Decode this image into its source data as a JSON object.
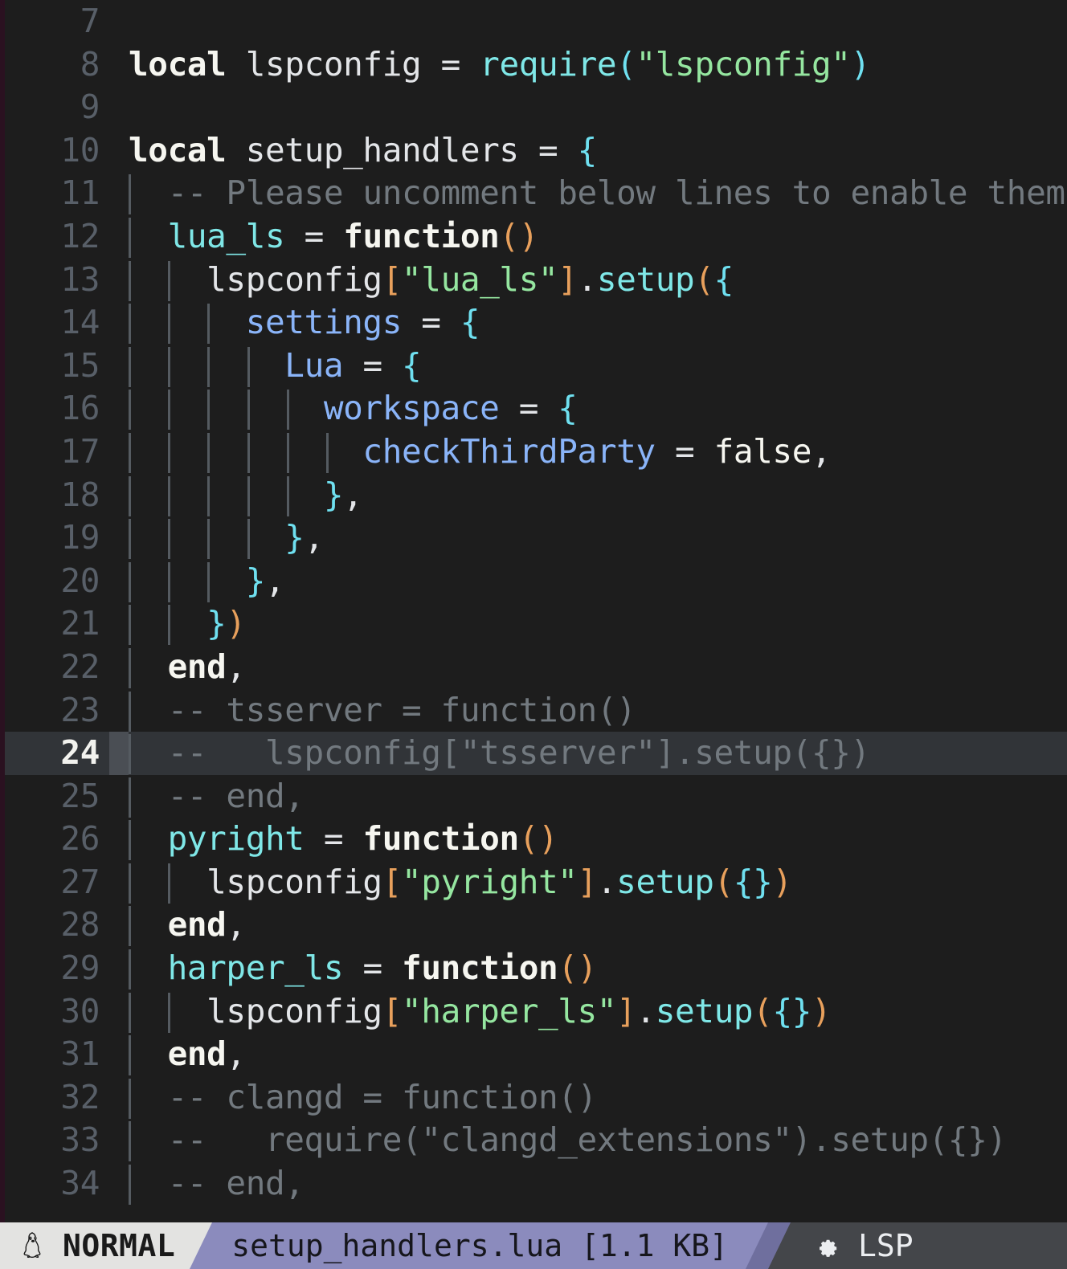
{
  "editor": {
    "filetype": "lua",
    "first_visible_line": 7,
    "cursor_line": 24,
    "colors": {
      "background": "#1d1d1d",
      "cursorline": "#313438",
      "linenr": "#585f68",
      "linenr_cursor": "#f2f2ee",
      "comment": "#72797f",
      "string": "#95e6a0",
      "keyword": "#f6f6f0",
      "function": "#7fe7e7",
      "property": "#8ab4f8",
      "bracket_level1": "#6fe0f0",
      "bracket_level2": "#e8a05c",
      "bracket_level3": "#9ce6a6",
      "indent_guide": "#555b61",
      "window_edge": "#2a1120"
    },
    "lines": [
      {
        "num": 7,
        "guides": [],
        "tokens": []
      },
      {
        "num": 8,
        "guides": [],
        "tokens": [
          {
            "t": "local",
            "c": "kw"
          },
          {
            "t": " ",
            "c": "op"
          },
          {
            "t": "lspconfig",
            "c": "ident"
          },
          {
            "t": " ",
            "c": "op"
          },
          {
            "t": "=",
            "c": "op"
          },
          {
            "t": " ",
            "c": "op"
          },
          {
            "t": "require",
            "c": "fn"
          },
          {
            "t": "(",
            "c": "b1"
          },
          {
            "t": "\"lspconfig\"",
            "c": "str"
          },
          {
            "t": ")",
            "c": "b1"
          }
        ]
      },
      {
        "num": 9,
        "guides": [],
        "tokens": []
      },
      {
        "num": 10,
        "guides": [],
        "tokens": [
          {
            "t": "local",
            "c": "kw"
          },
          {
            "t": " ",
            "c": "op"
          },
          {
            "t": "setup_handlers",
            "c": "ident"
          },
          {
            "t": " ",
            "c": "op"
          },
          {
            "t": "=",
            "c": "op"
          },
          {
            "t": " ",
            "c": "op"
          },
          {
            "t": "{",
            "c": "b1"
          }
        ]
      },
      {
        "num": 11,
        "guides": [
          0
        ],
        "tokens": [
          {
            "t": "  -- Please uncomment below lines to enable them.",
            "c": "cmt"
          }
        ]
      },
      {
        "num": 12,
        "guides": [
          0
        ],
        "tokens": [
          {
            "t": "  ",
            "c": "op"
          },
          {
            "t": "lua_ls",
            "c": "field"
          },
          {
            "t": " ",
            "c": "op"
          },
          {
            "t": "=",
            "c": "op"
          },
          {
            "t": " ",
            "c": "op"
          },
          {
            "t": "function",
            "c": "kw"
          },
          {
            "t": "(",
            "c": "b2"
          },
          {
            "t": ")",
            "c": "b2"
          }
        ]
      },
      {
        "num": 13,
        "guides": [
          0,
          1
        ],
        "tokens": [
          {
            "t": "    ",
            "c": "op"
          },
          {
            "t": "lspconfig",
            "c": "ident"
          },
          {
            "t": "[",
            "c": "b2"
          },
          {
            "t": "\"lua_ls\"",
            "c": "str"
          },
          {
            "t": "]",
            "c": "b2"
          },
          {
            "t": ".",
            "c": "punc"
          },
          {
            "t": "setup",
            "c": "fn"
          },
          {
            "t": "(",
            "c": "b2"
          },
          {
            "t": "{",
            "c": "b1"
          }
        ]
      },
      {
        "num": 14,
        "guides": [
          0,
          1,
          2
        ],
        "tokens": [
          {
            "t": "      ",
            "c": "op"
          },
          {
            "t": "settings",
            "c": "key"
          },
          {
            "t": " ",
            "c": "op"
          },
          {
            "t": "=",
            "c": "op"
          },
          {
            "t": " ",
            "c": "op"
          },
          {
            "t": "{",
            "c": "b1"
          }
        ]
      },
      {
        "num": 15,
        "guides": [
          0,
          1,
          2,
          3
        ],
        "tokens": [
          {
            "t": "        ",
            "c": "op"
          },
          {
            "t": "Lua",
            "c": "key"
          },
          {
            "t": " ",
            "c": "op"
          },
          {
            "t": "=",
            "c": "op"
          },
          {
            "t": " ",
            "c": "op"
          },
          {
            "t": "{",
            "c": "b1"
          }
        ]
      },
      {
        "num": 16,
        "guides": [
          0,
          1,
          2,
          3,
          4
        ],
        "tokens": [
          {
            "t": "          ",
            "c": "op"
          },
          {
            "t": "workspace",
            "c": "key"
          },
          {
            "t": " ",
            "c": "op"
          },
          {
            "t": "=",
            "c": "op"
          },
          {
            "t": " ",
            "c": "op"
          },
          {
            "t": "{",
            "c": "b1"
          }
        ]
      },
      {
        "num": 17,
        "guides": [
          0,
          1,
          2,
          3,
          4,
          5
        ],
        "tokens": [
          {
            "t": "            ",
            "c": "op"
          },
          {
            "t": "checkThirdParty",
            "c": "key"
          },
          {
            "t": " ",
            "c": "op"
          },
          {
            "t": "=",
            "c": "op"
          },
          {
            "t": " ",
            "c": "op"
          },
          {
            "t": "false",
            "c": "bool"
          },
          {
            "t": ",",
            "c": "punc"
          }
        ]
      },
      {
        "num": 18,
        "guides": [
          0,
          1,
          2,
          3,
          4
        ],
        "tokens": [
          {
            "t": "          ",
            "c": "op"
          },
          {
            "t": "}",
            "c": "b1"
          },
          {
            "t": ",",
            "c": "punc"
          }
        ]
      },
      {
        "num": 19,
        "guides": [
          0,
          1,
          2,
          3
        ],
        "tokens": [
          {
            "t": "        ",
            "c": "op"
          },
          {
            "t": "}",
            "c": "b1"
          },
          {
            "t": ",",
            "c": "punc"
          }
        ]
      },
      {
        "num": 20,
        "guides": [
          0,
          1,
          2
        ],
        "tokens": [
          {
            "t": "      ",
            "c": "op"
          },
          {
            "t": "}",
            "c": "b1"
          },
          {
            "t": ",",
            "c": "punc"
          }
        ]
      },
      {
        "num": 21,
        "guides": [
          0,
          1
        ],
        "tokens": [
          {
            "t": "    ",
            "c": "op"
          },
          {
            "t": "}",
            "c": "b1"
          },
          {
            "t": ")",
            "c": "b2"
          }
        ]
      },
      {
        "num": 22,
        "guides": [
          0
        ],
        "tokens": [
          {
            "t": "  ",
            "c": "op"
          },
          {
            "t": "end",
            "c": "kw"
          },
          {
            "t": ",",
            "c": "punc"
          }
        ]
      },
      {
        "num": 23,
        "guides": [
          0
        ],
        "tokens": [
          {
            "t": "  -- tsserver = function()",
            "c": "cmt"
          }
        ]
      },
      {
        "num": 24,
        "guides": [
          0
        ],
        "tokens": [
          {
            "t": "  --   lspconfig[\"tsserver\"].setup({})",
            "c": "cmt"
          }
        ]
      },
      {
        "num": 25,
        "guides": [
          0
        ],
        "tokens": [
          {
            "t": "  -- end,",
            "c": "cmt"
          }
        ]
      },
      {
        "num": 26,
        "guides": [
          0
        ],
        "tokens": [
          {
            "t": "  ",
            "c": "op"
          },
          {
            "t": "pyright",
            "c": "field"
          },
          {
            "t": " ",
            "c": "op"
          },
          {
            "t": "=",
            "c": "op"
          },
          {
            "t": " ",
            "c": "op"
          },
          {
            "t": "function",
            "c": "kw"
          },
          {
            "t": "(",
            "c": "b2"
          },
          {
            "t": ")",
            "c": "b2"
          }
        ]
      },
      {
        "num": 27,
        "guides": [
          0,
          1
        ],
        "tokens": [
          {
            "t": "    ",
            "c": "op"
          },
          {
            "t": "lspconfig",
            "c": "ident"
          },
          {
            "t": "[",
            "c": "b2"
          },
          {
            "t": "\"pyright\"",
            "c": "str"
          },
          {
            "t": "]",
            "c": "b2"
          },
          {
            "t": ".",
            "c": "punc"
          },
          {
            "t": "setup",
            "c": "fn"
          },
          {
            "t": "(",
            "c": "b2"
          },
          {
            "t": "{",
            "c": "b1"
          },
          {
            "t": "}",
            "c": "b1"
          },
          {
            "t": ")",
            "c": "b2"
          }
        ]
      },
      {
        "num": 28,
        "guides": [
          0
        ],
        "tokens": [
          {
            "t": "  ",
            "c": "op"
          },
          {
            "t": "end",
            "c": "kw"
          },
          {
            "t": ",",
            "c": "punc"
          }
        ]
      },
      {
        "num": 29,
        "guides": [
          0
        ],
        "tokens": [
          {
            "t": "  ",
            "c": "op"
          },
          {
            "t": "harper_ls",
            "c": "field"
          },
          {
            "t": " ",
            "c": "op"
          },
          {
            "t": "=",
            "c": "op"
          },
          {
            "t": " ",
            "c": "op"
          },
          {
            "t": "function",
            "c": "kw"
          },
          {
            "t": "(",
            "c": "b2"
          },
          {
            "t": ")",
            "c": "b2"
          }
        ]
      },
      {
        "num": 30,
        "guides": [
          0,
          1
        ],
        "tokens": [
          {
            "t": "    ",
            "c": "op"
          },
          {
            "t": "lspconfig",
            "c": "ident"
          },
          {
            "t": "[",
            "c": "b2"
          },
          {
            "t": "\"harper_ls\"",
            "c": "str"
          },
          {
            "t": "]",
            "c": "b2"
          },
          {
            "t": ".",
            "c": "punc"
          },
          {
            "t": "setup",
            "c": "fn"
          },
          {
            "t": "(",
            "c": "b2"
          },
          {
            "t": "{",
            "c": "b1"
          },
          {
            "t": "}",
            "c": "b1"
          },
          {
            "t": ")",
            "c": "b2"
          }
        ]
      },
      {
        "num": 31,
        "guides": [
          0
        ],
        "tokens": [
          {
            "t": "  ",
            "c": "op"
          },
          {
            "t": "end",
            "c": "kw"
          },
          {
            "t": ",",
            "c": "punc"
          }
        ]
      },
      {
        "num": 32,
        "guides": [
          0
        ],
        "tokens": [
          {
            "t": "  -- clangd = function()",
            "c": "cmt"
          }
        ]
      },
      {
        "num": 33,
        "guides": [
          0
        ],
        "tokens": [
          {
            "t": "  --   require(\"clangd_extensions\").setup({})",
            "c": "cmt"
          }
        ]
      },
      {
        "num": 34,
        "guides": [
          0
        ],
        "tokens": [
          {
            "t": "  -- end,",
            "c": "cmt"
          }
        ]
      }
    ]
  },
  "statusline": {
    "mode_icon": "tux-icon",
    "mode": "NORMAL",
    "file": "setup_handlers.lua [1.1 KB]",
    "filename": "setup_handlers.lua",
    "filesize": "1.1 KB",
    "lsp_icon": "gear-icon",
    "lsp": "LSP",
    "colors": {
      "mode_bg": "#e3e3e1",
      "mode_fg": "#1a1a1a",
      "file_bg": "#8b8bbd",
      "file_fg": "#16161c",
      "file_sep_bg": "#6f6f9e",
      "lsp_bg": "#44464a",
      "lsp_fg": "#eceef1"
    }
  }
}
